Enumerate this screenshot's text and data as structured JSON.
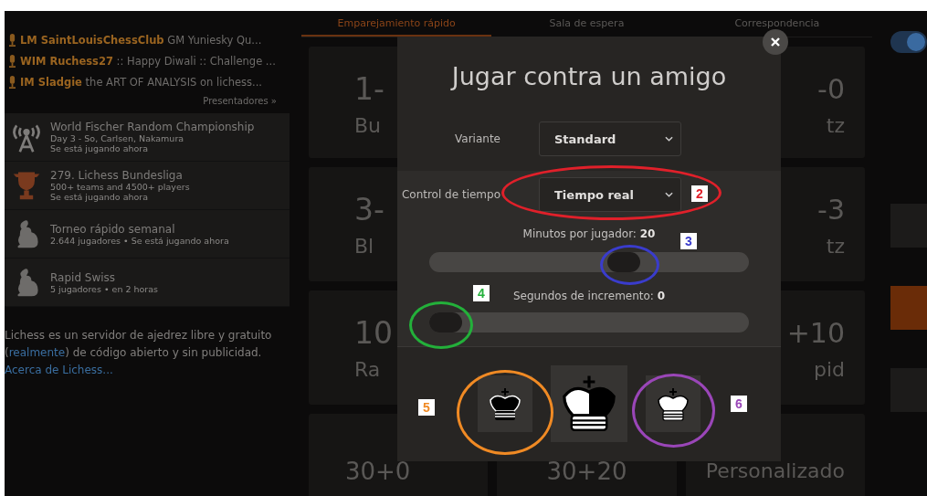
{
  "streamers": [
    {
      "name": "LM SaintLouisChessClub",
      "text": "GM Yuniesky Qu..."
    },
    {
      "name": "WIM Ruchess27",
      "text": ":: Happy Diwali :: Challenge ..."
    },
    {
      "name": "IM Sladgie",
      "text": "the ART OF ANALYSIS on lichess..."
    }
  ],
  "streamers_link": "Presentadores »",
  "events": [
    {
      "kind": "broadcast",
      "title": "World Fischer Random Championship",
      "subtitle": "Day 3 - So, Carlsen, Nakamura",
      "status": "Se está jugando ahora"
    },
    {
      "kind": "trophy",
      "title": "279. Lichess Bundesliga",
      "subtitle": "500+ teams and 4500+ players",
      "status": "Se está jugando ahora"
    },
    {
      "kind": "rabbit",
      "title": "Torneo rápido semanal",
      "subtitle": "2.644 jugadores • Se está jugando ahora"
    },
    {
      "kind": "rabbit",
      "title": "Rapid Swiss",
      "subtitle": "5 jugadores •  en 2 horas"
    }
  ],
  "about": {
    "before": "Lichess es un servidor de ajedrez libre y gratuito (",
    "link": "realmente",
    "middle": ") de código abierto y sin publicidad.",
    "link2": "Acerca de Lichess..."
  },
  "tabs": [
    {
      "label": "Emparejamiento rápido",
      "selected": true
    },
    {
      "label": "Sala de espera",
      "selected": false
    },
    {
      "label": "Correspondencia",
      "selected": false
    }
  ],
  "toggle": {
    "on": true
  },
  "pools_left": [
    {
      "time": "1-",
      "name": "Bu"
    },
    {
      "time": "3-",
      "name": "Bl"
    },
    {
      "time": "10",
      "name": "Ra"
    }
  ],
  "pools_right": [
    {
      "time": "-0",
      "name": "tz"
    },
    {
      "time": "-3",
      "name": "tz"
    },
    {
      "time": "+10",
      "name": "pid"
    }
  ],
  "pools_bottom": [
    {
      "time": "30+0"
    },
    {
      "time": "30+20"
    },
    {
      "time": "Personalizado"
    }
  ],
  "dialog": {
    "title": "Jugar contra un amigo",
    "variant_label": "Variante",
    "variant": "Standard",
    "time_control_label": "Control de tiempo",
    "time_control": "Tiempo real",
    "sliders": [
      {
        "label": "Minutos por jugador:",
        "value": "20",
        "level": 0.62
      },
      {
        "label": "Segundos de incremento:",
        "value": "0",
        "level": 0
      }
    ],
    "colors": [
      {
        "kind": "black"
      },
      {
        "kind": "random"
      },
      {
        "kind": "white"
      }
    ]
  },
  "annotations": [
    {
      "label": "2",
      "color": "#e0202a"
    },
    {
      "label": "3",
      "color": "#3a3ccc"
    },
    {
      "label": "4",
      "color": "#23b03a"
    },
    {
      "label": "5",
      "color": "#f08a24"
    },
    {
      "label": "6",
      "color": "#9a46b8"
    }
  ]
}
